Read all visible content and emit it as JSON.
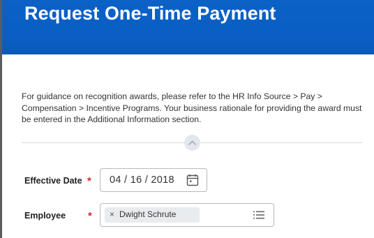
{
  "header": {
    "title": "Request One-Time Payment",
    "color": "#0b5fc4"
  },
  "guidance": {
    "text": "For guidance on recognition awards, please refer to the HR Info Source > Pay > Compensation > Incentive Programs. Your business rationale for providing the award must be entered in the Additional Information section."
  },
  "section_toggle": {
    "icon": "chevron-up-icon"
  },
  "form": {
    "required_marker": "*",
    "required_color": "#d12a2a",
    "effective_date": {
      "label": "Effective Date",
      "value": "04 / 16 / 2018",
      "icon": "calendar-icon"
    },
    "employee": {
      "label": "Employee",
      "selected": "Dwight Schrute",
      "remove_glyph": "×",
      "icon": "list-icon"
    }
  }
}
